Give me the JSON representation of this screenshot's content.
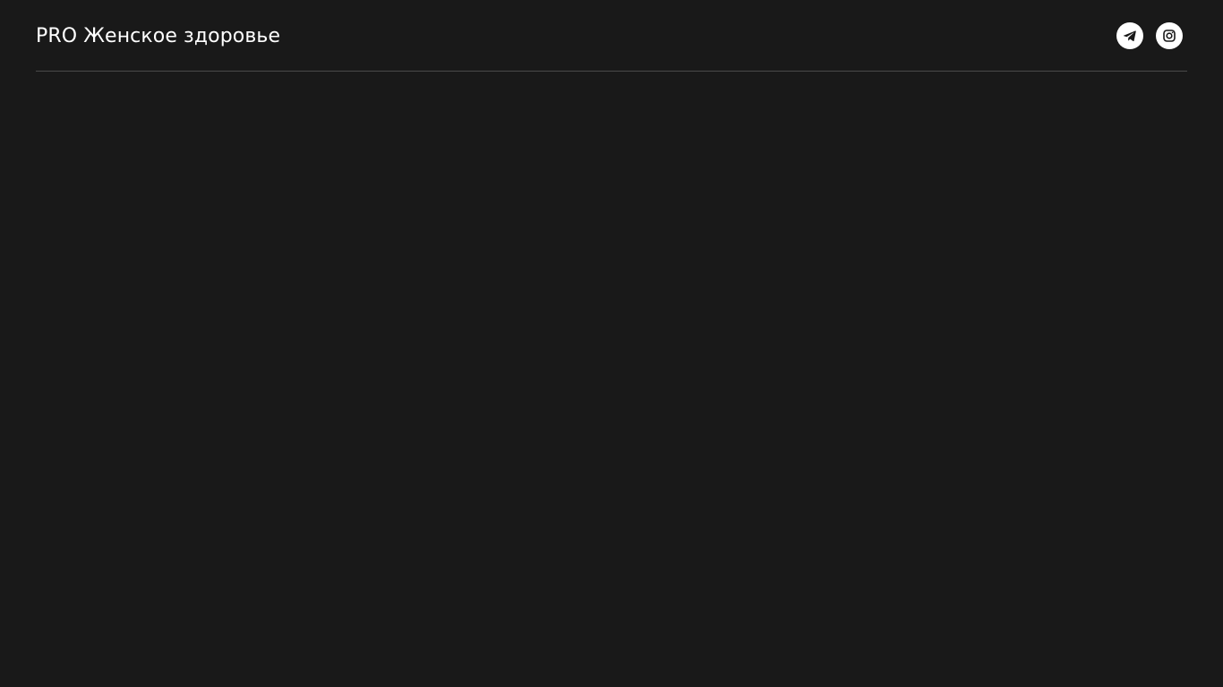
{
  "header": {
    "title": "PRO Женское здоровье",
    "socials": [
      {
        "icon": "telegram-icon"
      },
      {
        "icon": "instagram-icon"
      }
    ]
  },
  "colors": {
    "background": "#191919",
    "text": "#ffffff",
    "divider": "#4a4a4a",
    "icon_bg": "#ffffff",
    "icon_fg": "#191919"
  }
}
